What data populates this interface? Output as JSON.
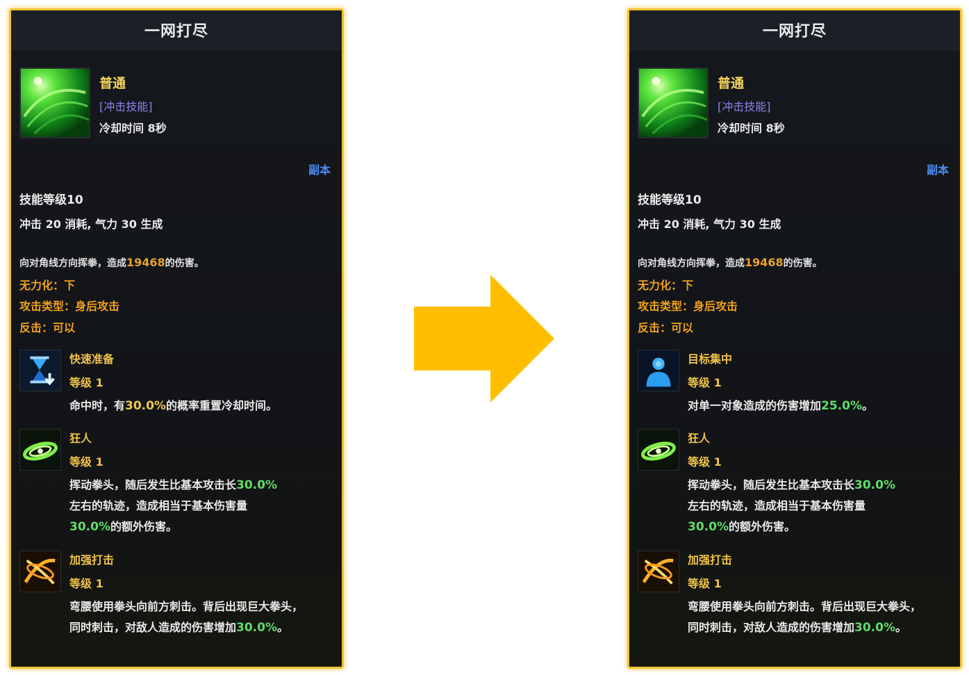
{
  "colors": {
    "frame": "#f2c230",
    "arrow": "#ffbf00",
    "skill_name": "#f1d45c",
    "skill_type": "#8c82ee",
    "tag": "#4d8ef2",
    "attribute": "#f0a21c",
    "damage_number": "#e9a22a",
    "percent_green": "#5fdc6a",
    "percent_yellow": "#eec74e"
  },
  "arrow": {
    "icon": "arrow-right-icon"
  },
  "left": {
    "title": "一网打尽",
    "skill": {
      "icon": "green-swirl-icon",
      "name": "普通",
      "type": "[冲击技能]",
      "cooldown": "冷却时间 8秒"
    },
    "tag": "副本",
    "level": "技能等级10",
    "cost": "冲击 20 消耗, 气力 30 生成",
    "desc": {
      "pre": "向对角线方向挥拳，造成",
      "num": "19468",
      "post": "的伤害。"
    },
    "attrs": [
      "无力化：下",
      "攻击类型：身后攻击",
      "反击：可以"
    ],
    "runes": [
      {
        "icon": "hourglass-icon",
        "name": "快速准备",
        "level": "等级 1",
        "t1": "命中时，有",
        "p1": "30.0%",
        "t2": "的概率重置冷却时间。"
      },
      {
        "icon": "green-slash-icon",
        "name": "狂人",
        "level": "等级 1",
        "t1": "挥动拳头，随后发生比基本攻击长",
        "p1": "30.0%",
        "t2": "左右的轨迹，造成相当于基本伤害量",
        "p2": "30.0%",
        "t3": "的额外伤害。"
      },
      {
        "icon": "orange-strike-icon",
        "name": "加强打击",
        "level": "等级 1",
        "t1": "弯腰使用拳头向前方刺击。背后出现巨大拳头，同时刺击，对敌人造成的伤害增加",
        "p1": "30.0%",
        "t2": "。"
      }
    ]
  },
  "right": {
    "title": "一网打尽",
    "skill": {
      "icon": "green-swirl-icon",
      "name": "普通",
      "type": "[冲击技能]",
      "cooldown": "冷却时间 8秒"
    },
    "tag": "副本",
    "level": "技能等级10",
    "cost": "冲击 20 消耗, 气力 30 生成",
    "desc": {
      "pre": "向对角线方向挥拳，造成",
      "num": "19468",
      "post": "的伤害。"
    },
    "attrs": [
      "无力化：下",
      "攻击类型：身后攻击",
      "反击：可以"
    ],
    "runes": [
      {
        "icon": "person-target-icon",
        "name": "目标集中",
        "level": "等级 1",
        "t1": "对单一对象造成的伤害增加",
        "p1": "25.0%",
        "t2": "。"
      },
      {
        "icon": "green-slash-icon",
        "name": "狂人",
        "level": "等级 1",
        "t1": "挥动拳头，随后发生比基本攻击长",
        "p1": "30.0%",
        "t2": "左右的轨迹，造成相当于基本伤害量",
        "p2": "30.0%",
        "t3": "的额外伤害。"
      },
      {
        "icon": "orange-strike-icon",
        "name": "加强打击",
        "level": "等级 1",
        "t1": "弯腰使用拳头向前方刺击。背后出现巨大拳头，同时刺击，对敌人造成的伤害增加",
        "p1": "30.0%",
        "t2": "。"
      }
    ]
  }
}
